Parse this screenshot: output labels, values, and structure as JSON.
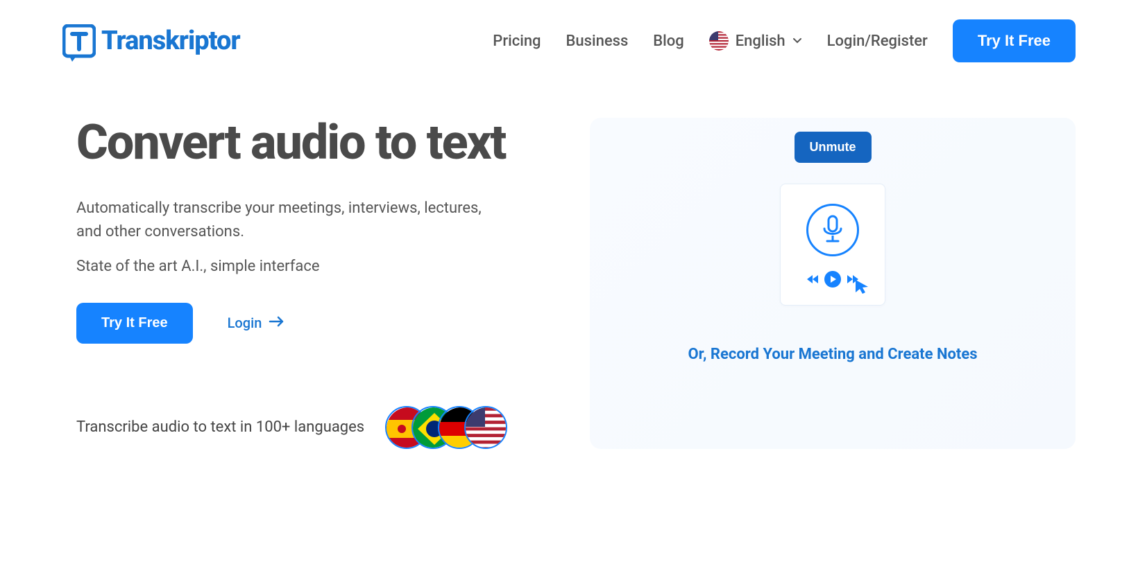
{
  "brand": {
    "name": "Transkriptor"
  },
  "nav": {
    "pricing": "Pricing",
    "business": "Business",
    "blog": "Blog",
    "language": "English",
    "login_register": "Login/Register",
    "cta": "Try It Free"
  },
  "hero": {
    "title": "Convert audio to text",
    "desc": "Automatically transcribe your meetings, interviews, lectures, and other conversations.",
    "subdesc": "State of the art A.I., simple interface",
    "try_free": "Try It Free",
    "login": "Login",
    "languages_text": "Transcribe audio to text in 100+ languages"
  },
  "right": {
    "unmute": "Unmute",
    "cta": "Or, Record Your Meeting and Create Notes"
  },
  "flags": {
    "header": "us",
    "stack": [
      "es",
      "br",
      "de",
      "us"
    ]
  },
  "colors": {
    "primary": "#1683ff",
    "primary_dark": "#1565c0",
    "link": "#1976d2",
    "text_dark": "#4a4a4a",
    "text_body": "#555"
  }
}
